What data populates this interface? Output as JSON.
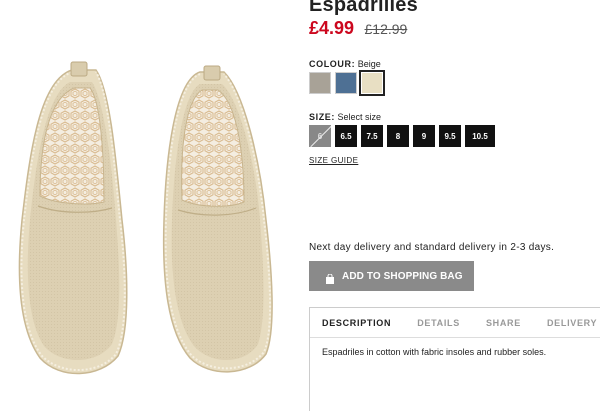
{
  "product": {
    "title": "Espadrilles",
    "price": "£4.99",
    "old_price": "£12.99",
    "image_icon": "espadrille-pair-image"
  },
  "colour": {
    "label": "COLOUR:",
    "value": "Beige",
    "swatches": [
      {
        "color": "#a8a297"
      },
      {
        "color": "#4e7094"
      },
      {
        "color": "#e8dfc3"
      }
    ]
  },
  "size": {
    "label": "SIZE:",
    "value": "Select size",
    "options": [
      "6",
      "6.5",
      "7.5",
      "8",
      "9",
      "9.5",
      "10.5"
    ],
    "guide": "SIZE GUIDE"
  },
  "delivery_text": "Next day delivery and standard delivery in 2-3 days.",
  "add_to_bag": {
    "label": "ADD TO SHOPPING BAG",
    "icon": "shopping-bag-icon"
  },
  "details": {
    "tabs": [
      "DESCRIPTION",
      "DETAILS",
      "SHARE",
      "DELIVERY AN"
    ],
    "description": "Espadriles in cotton with fabric insoles and rubber soles."
  },
  "colors": {
    "price": "#cc071e",
    "button": "#8a8a8a",
    "size_button": "#111111"
  }
}
